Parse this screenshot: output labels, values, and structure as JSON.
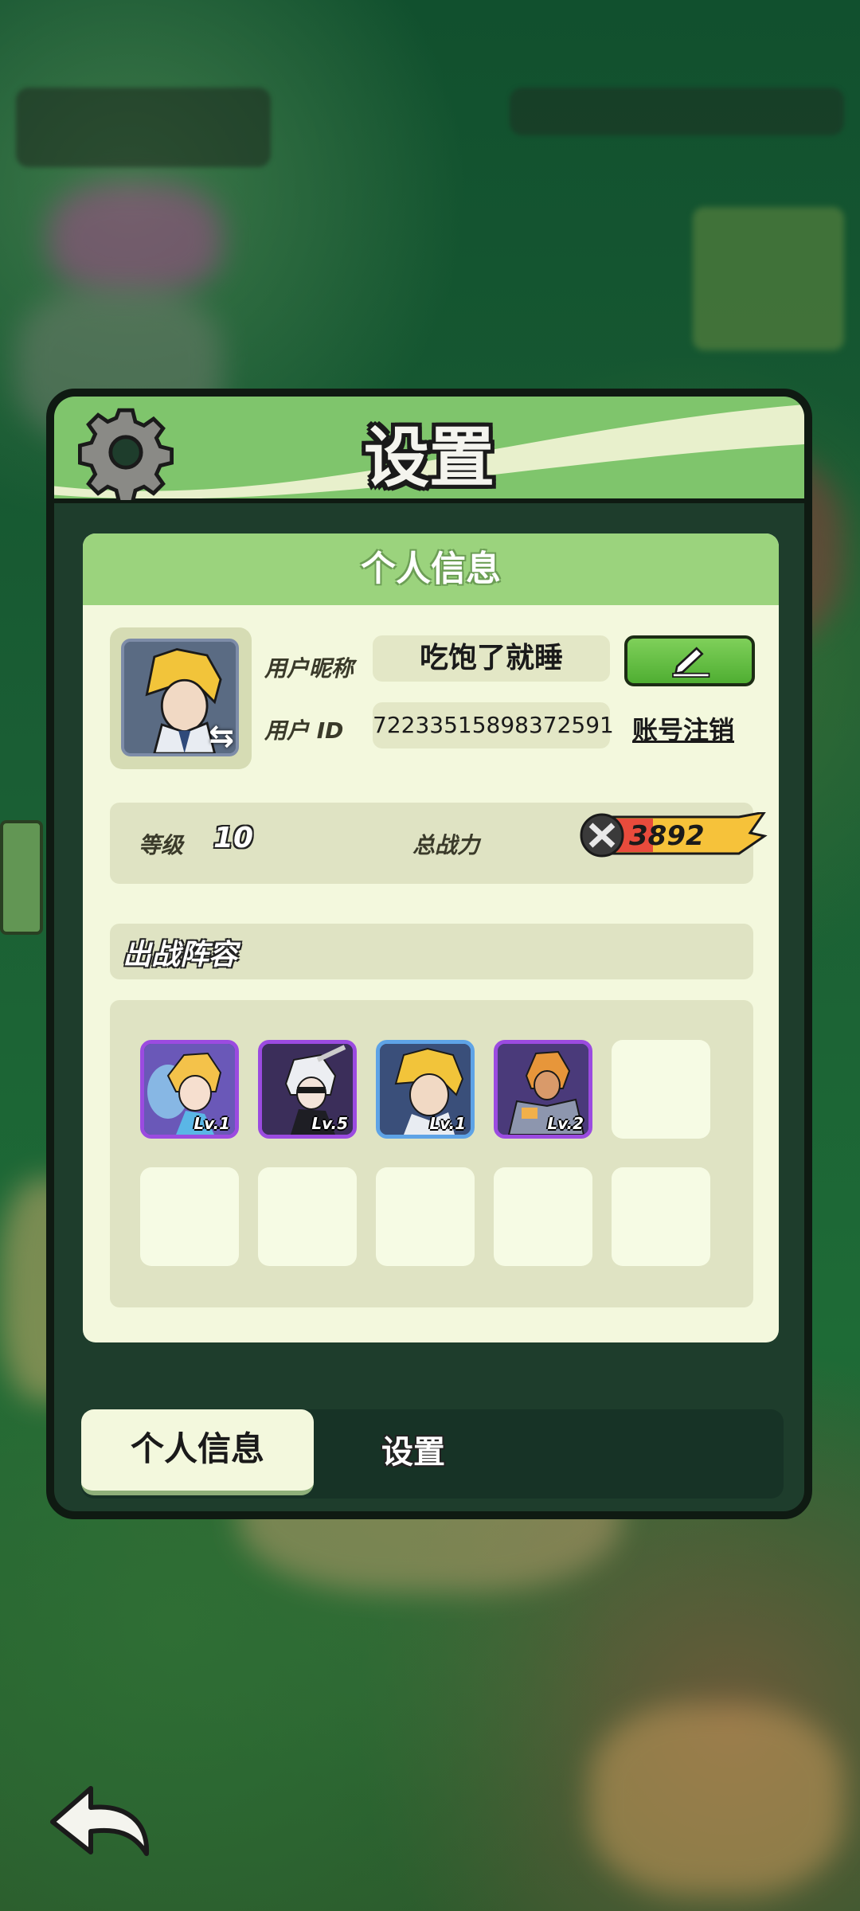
{
  "dialog": {
    "title": "设置",
    "icon": "gear-icon"
  },
  "profile": {
    "header": "个人信息",
    "nickname_label": "用户昵称",
    "nickname": "吃饱了就睡",
    "id_label": "用户 ID",
    "user_id": "72233515898372591",
    "edit_icon": "pencil-icon",
    "cancel_account": "账号注销",
    "level_label": "等级",
    "level": "10",
    "power_label": "总战力",
    "power": "3892"
  },
  "lineup": {
    "title": "出战阵容",
    "heroes": [
      {
        "name": "fairy-hero",
        "level": "Lv.1",
        "frame": "purple"
      },
      {
        "name": "masked-hero",
        "level": "Lv.5",
        "frame": "purple"
      },
      {
        "name": "blond-hero",
        "level": "Lv.1",
        "frame": "blue"
      },
      {
        "name": "armored-hero",
        "level": "Lv.2",
        "frame": "purple"
      }
    ],
    "slot_count": 10
  },
  "tabs": {
    "active": "个人信息",
    "other": "设置"
  },
  "colors": {
    "header_green": "#7fc56c",
    "panel_bg": "#f3f8dd",
    "frame_purple": "#9b4be0",
    "frame_blue": "#5ea3e6",
    "edit_green": "#4fae32"
  }
}
